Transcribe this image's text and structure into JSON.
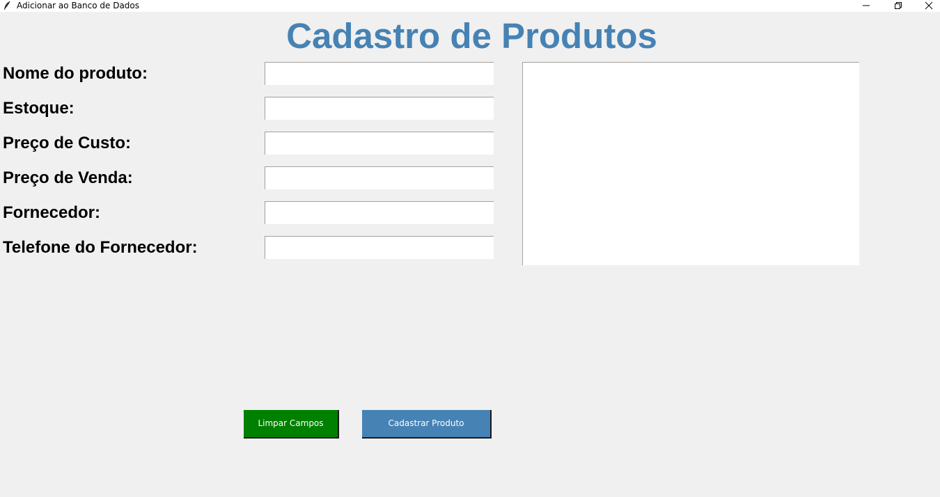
{
  "window": {
    "title": "Adicionar ao Banco de Dados",
    "icon": "feather-icon",
    "controls": [
      "minimize-icon",
      "restore-icon",
      "close-icon"
    ]
  },
  "heading": "Cadastro de Produtos",
  "form": {
    "fields": [
      {
        "label": "Nome do produto:",
        "value": ""
      },
      {
        "label": "Estoque:",
        "value": ""
      },
      {
        "label": "Preço de Custo:",
        "value": ""
      },
      {
        "label": "Preço de Venda:",
        "value": ""
      },
      {
        "label": "Fornecedor:",
        "value": ""
      },
      {
        "label": "Telefone do Fornecedor:",
        "value": ""
      }
    ]
  },
  "buttons": {
    "clear_label": "Limpar Campos",
    "register_label": "Cadastrar Produto"
  },
  "colors": {
    "heading": "#4682b4",
    "clear_button": "#008000",
    "register_button": "#4682b4",
    "background": "#f0f0f0"
  }
}
